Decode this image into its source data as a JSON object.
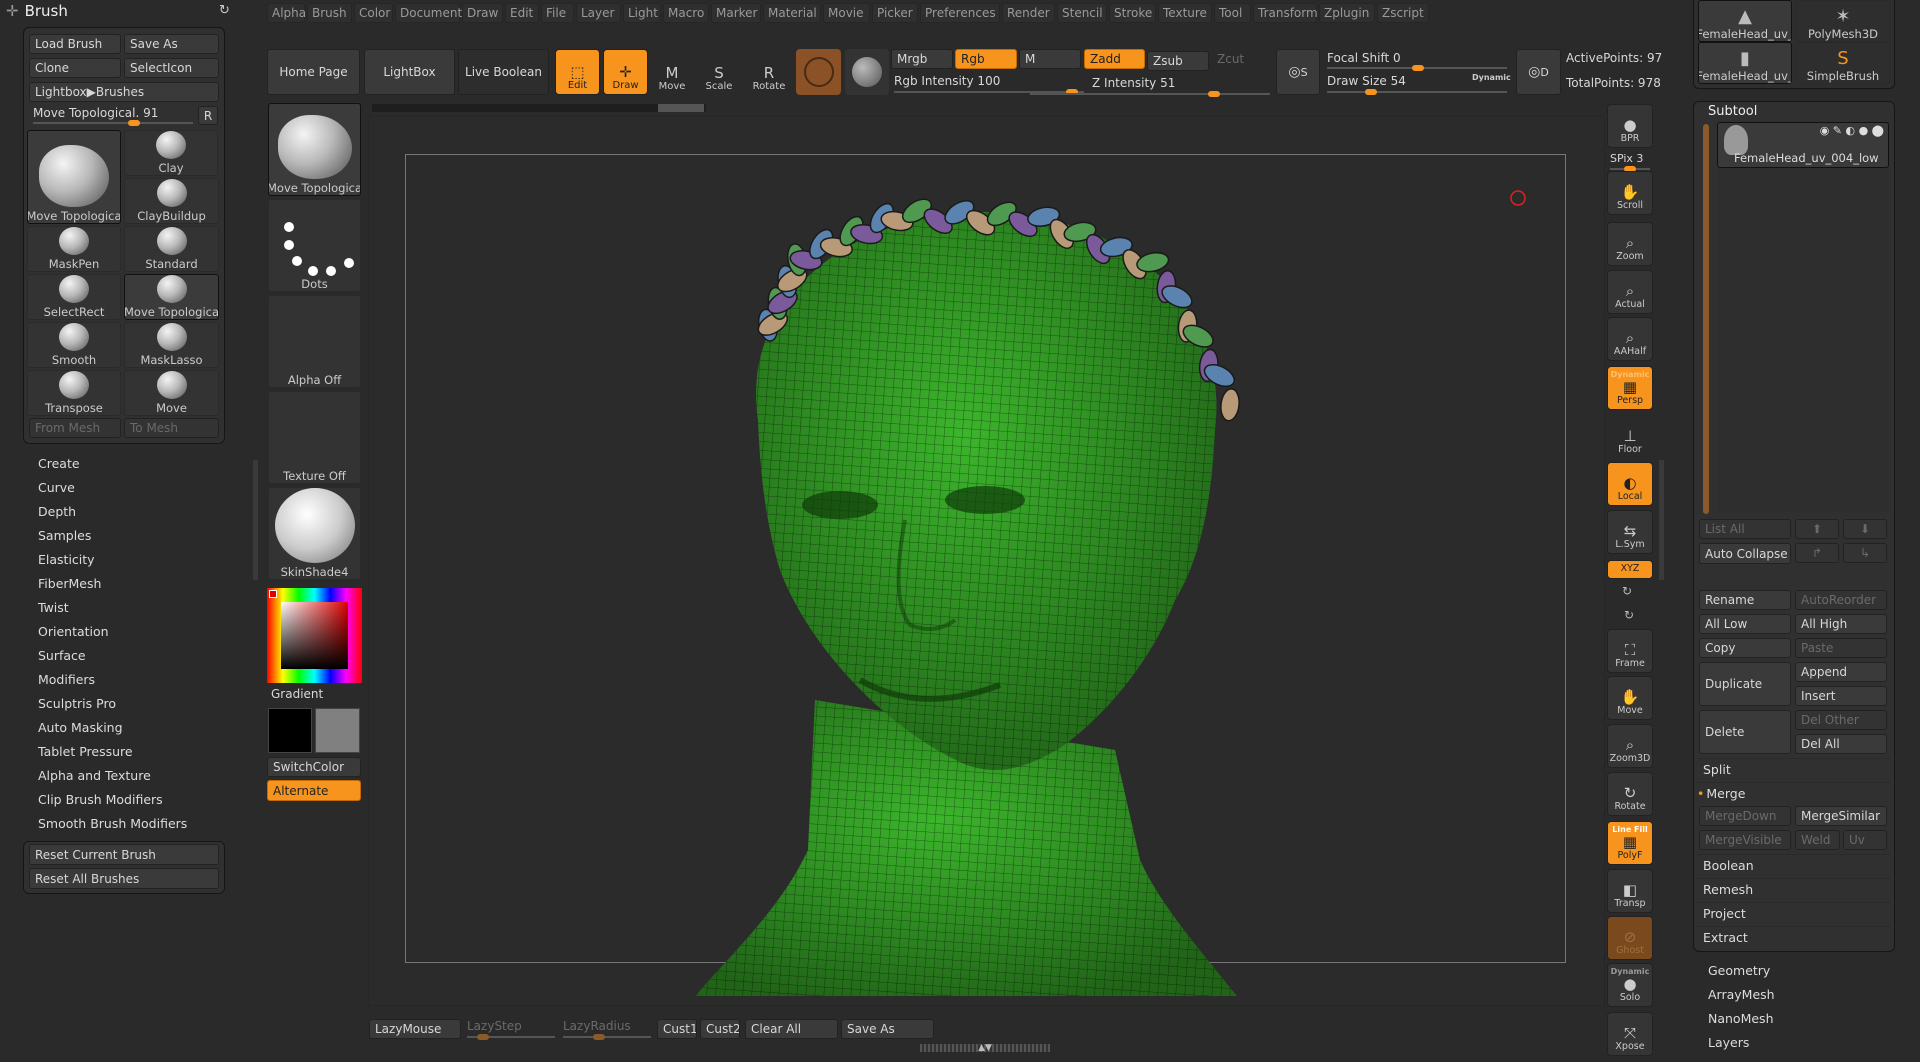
{
  "brush_palette": {
    "title": "Brush",
    "load_brush": "Load Brush",
    "save_as": "Save As",
    "clone": "Clone",
    "select_icon": "SelectIcon",
    "lightbox_brushes": "Lightbox▶Brushes",
    "current_brush_slider": {
      "label": "Move Topological. 91",
      "value": 91
    },
    "r_button": "R",
    "current_brush": "Move Topologica",
    "brushes": [
      "Clay",
      "ClayBuildup",
      "MaskPen",
      "Standard",
      "SelectRect",
      "Move Topologica",
      "Smooth",
      "MaskLasso",
      "Transpose",
      "Move"
    ],
    "from_mesh": "From Mesh",
    "to_mesh": "To Mesh",
    "submenus": [
      "Create",
      "Curve",
      "Depth",
      "Samples",
      "Elasticity",
      "FiberMesh",
      "Twist",
      "Orientation",
      "Surface",
      "Modifiers",
      "Sculptris Pro",
      "Auto Masking",
      "Tablet Pressure",
      "Alpha and Texture",
      "Clip Brush Modifiers",
      "Smooth Brush Modifiers"
    ],
    "reset_current": "Reset Current Brush",
    "reset_all": "Reset All Brushes"
  },
  "menubar": [
    "Alpha",
    "Brush",
    "Color",
    "Document",
    "Draw",
    "Edit",
    "File",
    "Layer",
    "Light",
    "Macro",
    "Marker",
    "Material",
    "Movie",
    "Picker",
    "Preferences",
    "Render",
    "Stencil",
    "Stroke",
    "Texture",
    "Tool",
    "Transform",
    "Zplugin",
    "Zscript"
  ],
  "shelf": {
    "brush": "Move Topologica",
    "stroke": "Dots",
    "alpha": "Alpha Off",
    "texture": "Texture Off",
    "material": "SkinShade4",
    "gradient": "Gradient",
    "switch_color": "SwitchColor",
    "alternate": "Alternate",
    "main_color": "#000000",
    "secondary_color": "#808080"
  },
  "top_toolbar": {
    "home_page": "Home Page",
    "lightbox": "LightBox",
    "live_boolean": "Live Boolean",
    "edit": "Edit",
    "draw": "Draw",
    "move": "Move",
    "scale": "Scale",
    "rotate": "Rotate",
    "mrgb": "Mrgb",
    "rgb": "Rgb",
    "m": "M",
    "zadd": "Zadd",
    "zsub": "Zsub",
    "zcut": "Zcut",
    "rgb_intensity": {
      "label": "Rgb Intensity 100",
      "value": 100
    },
    "z_intensity": {
      "label": "Z Intensity 51",
      "value": 51
    },
    "focal_shift": {
      "label": "Focal Shift 0",
      "value": 0
    },
    "draw_size": {
      "label": "Draw Size 54",
      "value": 54
    },
    "dynamic": "Dynamic",
    "s_btn": "S",
    "d_btn": "D",
    "active_points": "ActivePoints: 97",
    "total_points": "TotalPoints: 978"
  },
  "right_shelf": [
    "BPR",
    "SPix 3",
    "Scroll",
    "Zoom",
    "Actual",
    "AAHalf",
    "Persp",
    "Floor",
    "Local",
    "L.Sym",
    "XYZ",
    "Frame",
    "Move",
    "Zoom3D",
    "Rotate",
    "PolyF",
    "Transp",
    "Ghost",
    "Solo",
    "Xpose"
  ],
  "right_shelf_extra": {
    "persp_top": "Dynamic",
    "polyf_top": "Line Fill",
    "solo_top": "Dynamic",
    "spix_value": 3
  },
  "tool_thumbs": [
    "FemaleHead_uv_",
    "PolyMesh3D",
    "FemaleHead_uv_",
    "SimpleBrush"
  ],
  "subtool": {
    "title": "Subtool",
    "items": [
      "FemaleHead_uv_004_low"
    ],
    "list_all": "List All",
    "auto_collapse": "Auto Collapse",
    "rename": "Rename",
    "auto_reorder": "AutoReorder",
    "all_low": "All Low",
    "all_high": "All High",
    "copy": "Copy",
    "paste": "Paste",
    "duplicate": "Duplicate",
    "append": "Append",
    "insert": "Insert",
    "delete": "Delete",
    "del_other": "Del Other",
    "del_all": "Del All",
    "split": "Split",
    "merge": "Merge",
    "merge_down": "MergeDown",
    "merge_similar": "MergeSimilar",
    "merge_visible": "MergeVisible",
    "weld": "Weld",
    "uv": "Uv",
    "boolean": "Boolean",
    "remesh": "Remesh",
    "project": "Project",
    "extract": "Extract"
  },
  "tool_submenus": [
    "Geometry",
    "ArrayMesh",
    "NanoMesh",
    "Layers"
  ],
  "bottom_bar": {
    "lazymouse": "LazyMouse",
    "lazystep": "LazyStep",
    "lazyradius": "LazyRadius",
    "cust1": "Cust1",
    "cust2": "Cust2",
    "clear_all": "Clear All",
    "save_as": "Save As"
  },
  "colors": {
    "accent": "#f7941d",
    "mesh": "#3cb52c"
  }
}
